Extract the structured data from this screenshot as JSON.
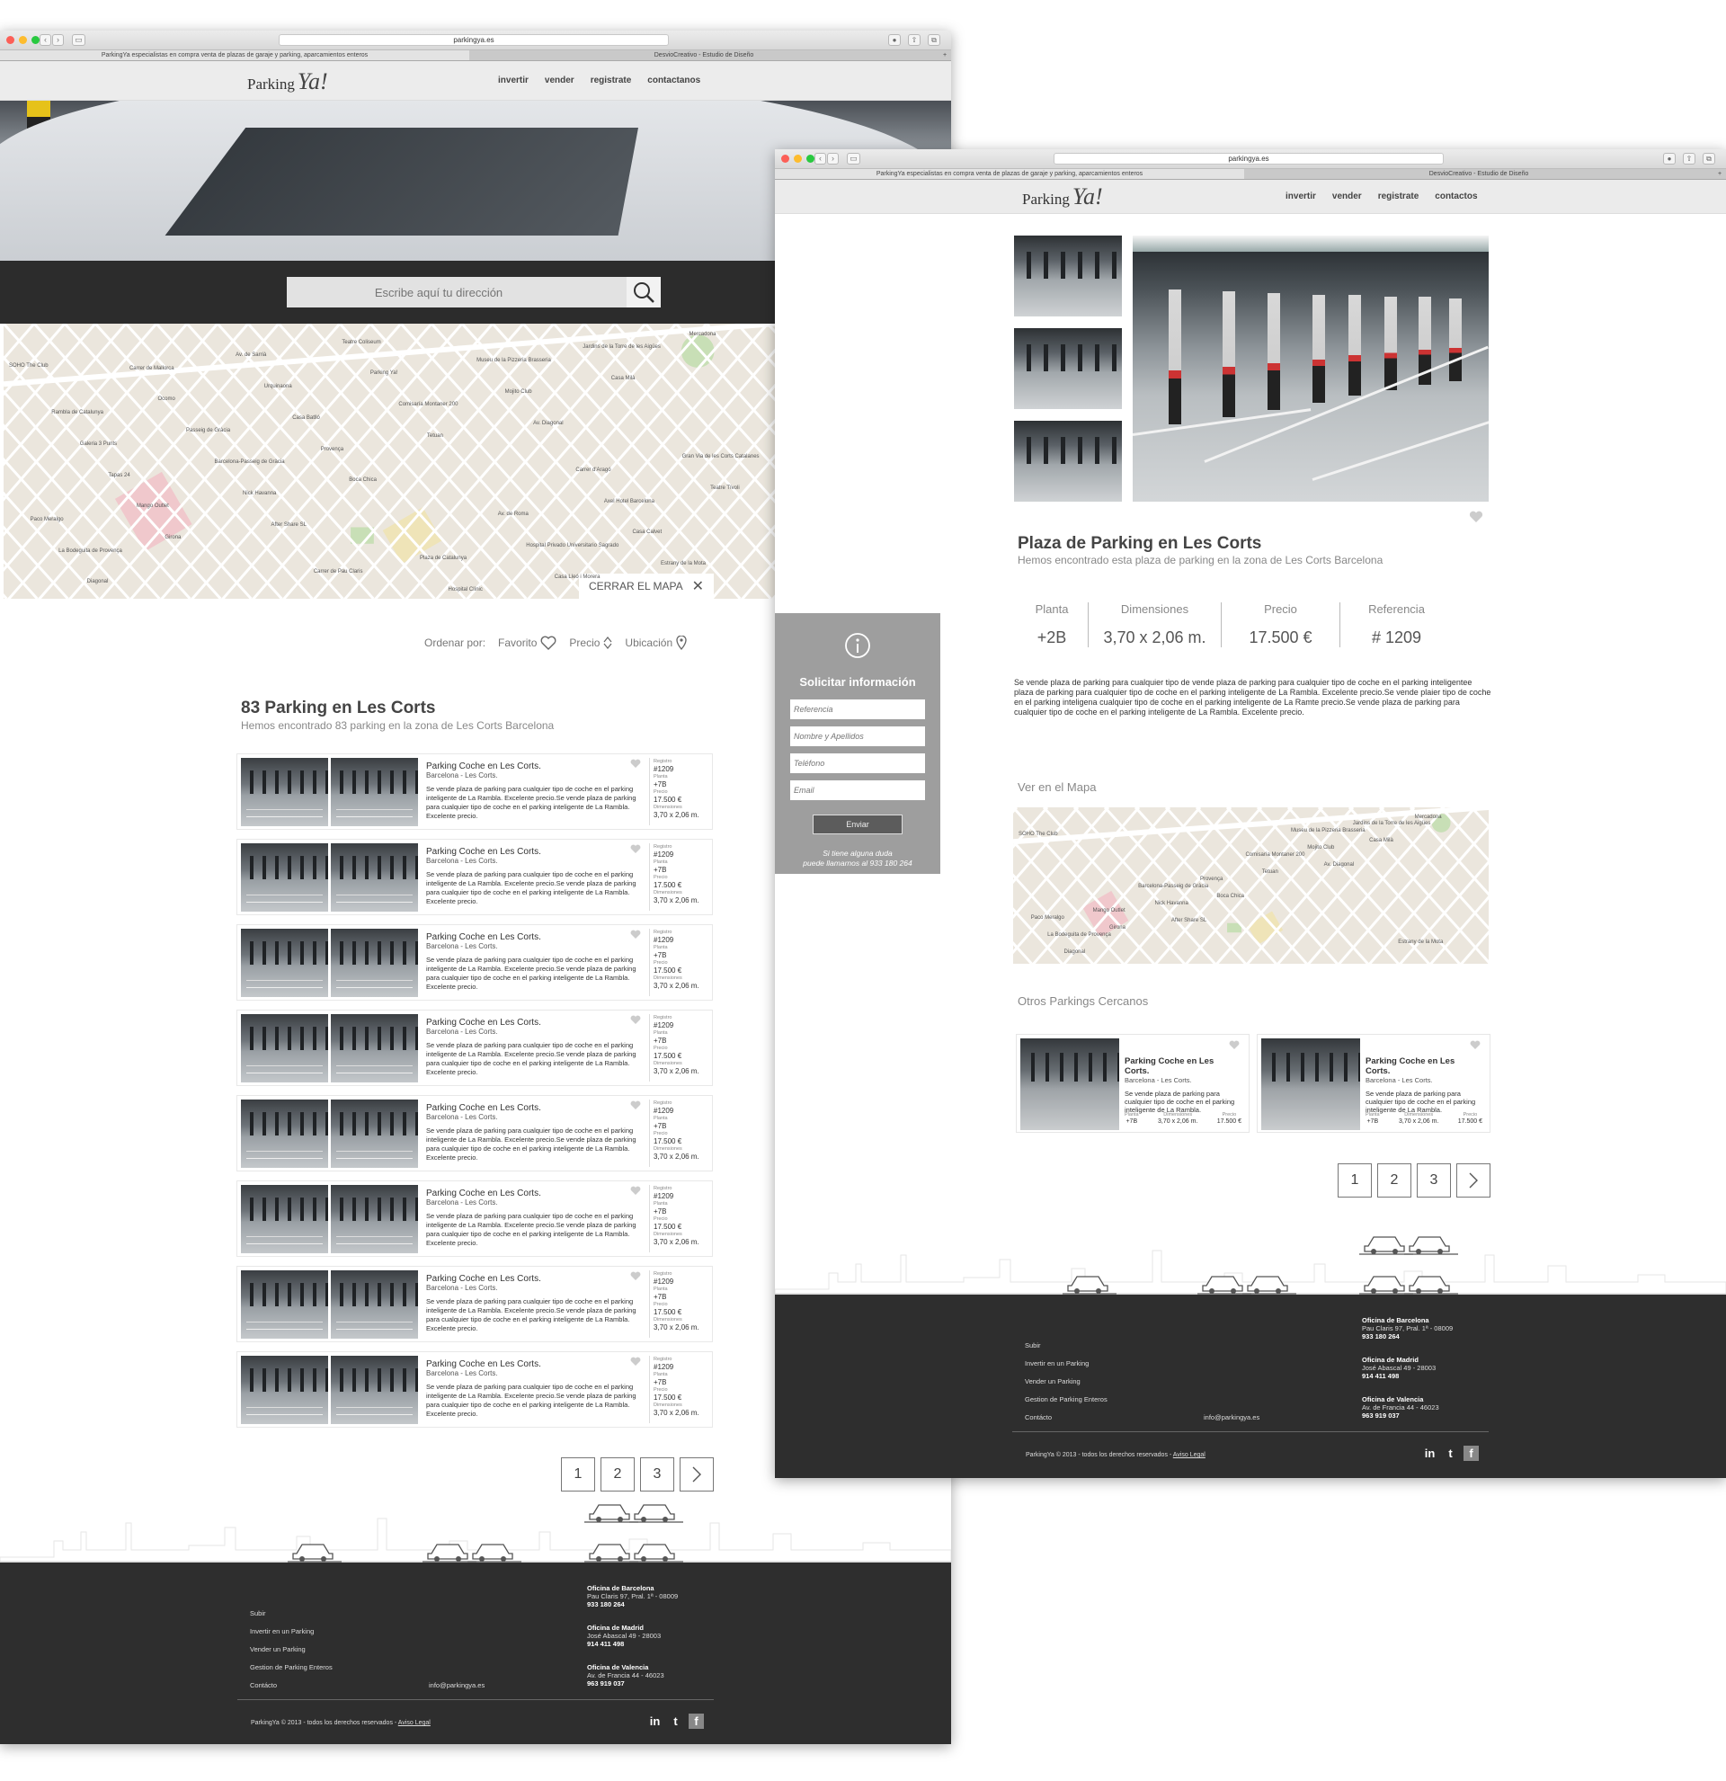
{
  "browser": {
    "url": "parkingya.es",
    "tab_active": "ParkingYa especialistas en compra venta de plazas de garaje y parking, aparcamientos enteros",
    "tab_other": "DesvioCreativo - Estudio de Diseño"
  },
  "brand": {
    "logo_text": "Parking",
    "logo_accent": "Ya!"
  },
  "nav": [
    "invertir",
    "vender",
    "registrate",
    "contactanos"
  ],
  "nav2": [
    "invertir",
    "vender",
    "registrate",
    "contactos"
  ],
  "search": {
    "placeholder": "Escribe aquí tu dirección"
  },
  "map": {
    "close_label": "CERRAR EL MAPA",
    "labels": [
      "SOHO The Club",
      "After Share SL",
      "Av. Diagonal",
      "Diagonal",
      "Boca Chica",
      "Casa Milà",
      "Girona",
      "Tetuan",
      "Mercadona",
      "Nick Havanna",
      "Mojito Club",
      "La Bodeguita de Provença",
      "Provença",
      "Jardins de la Torre de les Aigües",
      "Mango Outlet",
      "Comisaría Montaner 200",
      "Estrany de la Mota",
      "Barcelona-Passeig de Gràcia",
      "Museu de la Pizzeria Brasseria",
      "Paco Meralgo",
      "Casa Batlló",
      "Casa Lleó i Morera",
      "Tapas 24",
      "Parking Ya!",
      "Casa Calvet",
      "Passeig de Gràcia",
      "Hospital Clínic",
      "Teatre Tívoli",
      "Urquinaona",
      "Hospital Privado Universitario Sagrado",
      "Galeria 3 Punts",
      "Teatre Coliseum",
      "Axel Hotel Barcelona",
      "Ocomo",
      "Plaza de Catalunya",
      "Gran Via de les Corts Catalanes",
      "Av. de Sarrià",
      "Av. de Roma",
      "Rambla de Catalunya",
      "Carrer de Pau Claris",
      "Carrer d'Aragó",
      "Carrer de Mallorca"
    ]
  },
  "sort": {
    "label": "Ordenar por:",
    "options": [
      "Favorito",
      "Precio",
      "Ubicación"
    ]
  },
  "listing": {
    "title": "83 Parking en Les Corts",
    "subtitle": "Hemos encontrado 83 parking en la zona de Les Corts Barcelona",
    "items": [
      {
        "title": "Parking Coche en Les Corts.",
        "location": "Barcelona - Les Corts.",
        "desc": "Se vende plaza de parking para cualquier tipo de coche en el parking inteligente de La Rambla. Excelente precio.Se vende plaza de parking para cualquier tipo de coche en el parking inteligente de La Rambla. Excelente precio.",
        "registro_k": "Registro",
        "registro": "#1209",
        "planta_k": "Planta",
        "planta": "+7B",
        "precio_k": "Precio",
        "precio": "17.500 €",
        "dim_k": "Dimensiones",
        "dim": "3,70 x 2,06 m."
      },
      {
        "title": "Parking Coche en Les Corts.",
        "location": "Barcelona - Les Corts.",
        "desc": "Se vende plaza de parking para cualquier tipo de coche en el parking inteligente de La Rambla. Excelente precio.Se vende plaza de parking para cualquier tipo de coche en el parking inteligente de La Rambla. Excelente precio.",
        "registro_k": "Registro",
        "registro": "#1209",
        "planta_k": "Planta",
        "planta": "+7B",
        "precio_k": "Precio",
        "precio": "17.500 €",
        "dim_k": "Dimensiones",
        "dim": "3,70 x 2,06 m."
      },
      {
        "title": "Parking Coche en Les Corts.",
        "location": "Barcelona - Les Corts.",
        "desc": "Se vende plaza de parking para cualquier tipo de coche en el parking inteligente de La Rambla. Excelente precio.Se vende plaza de parking para cualquier tipo de coche en el parking inteligente de La Rambla. Excelente precio.",
        "registro_k": "Registro",
        "registro": "#1209",
        "planta_k": "Planta",
        "planta": "+7B",
        "precio_k": "Precio",
        "precio": "17.500 €",
        "dim_k": "Dimensiones",
        "dim": "3,70 x 2,06 m."
      },
      {
        "title": "Parking Coche en Les Corts.",
        "location": "Barcelona - Les Corts.",
        "desc": "Se vende plaza de parking para cualquier tipo de coche en el parking inteligente de La Rambla. Excelente precio.Se vende plaza de parking para cualquier tipo de coche en el parking inteligente de La Rambla. Excelente precio.",
        "registro_k": "Registro",
        "registro": "#1209",
        "planta_k": "Planta",
        "planta": "+7B",
        "precio_k": "Precio",
        "precio": "17.500 €",
        "dim_k": "Dimensiones",
        "dim": "3,70 x 2,06 m."
      },
      {
        "title": "Parking Coche en Les Corts.",
        "location": "Barcelona - Les Corts.",
        "desc": "Se vende plaza de parking para cualquier tipo de coche en el parking inteligente de La Rambla. Excelente precio.Se vende plaza de parking para cualquier tipo de coche en el parking inteligente de La Rambla. Excelente precio.",
        "registro_k": "Registro",
        "registro": "#1209",
        "planta_k": "Planta",
        "planta": "+7B",
        "precio_k": "Precio",
        "precio": "17.500 €",
        "dim_k": "Dimensiones",
        "dim": "3,70 x 2,06 m."
      },
      {
        "title": "Parking Coche en Les Corts.",
        "location": "Barcelona - Les Corts.",
        "desc": "Se vende plaza de parking para cualquier tipo de coche en el parking inteligente de La Rambla. Excelente precio.Se vende plaza de parking para cualquier tipo de coche en el parking inteligente de La Rambla. Excelente precio.",
        "registro_k": "Registro",
        "registro": "#1209",
        "planta_k": "Planta",
        "planta": "+7B",
        "precio_k": "Precio",
        "precio": "17.500 €",
        "dim_k": "Dimensiones",
        "dim": "3,70 x 2,06 m."
      },
      {
        "title": "Parking Coche en Les Corts.",
        "location": "Barcelona - Les Corts.",
        "desc": "Se vende plaza de parking para cualquier tipo de coche en el parking inteligente de La Rambla. Excelente precio.Se vende plaza de parking para cualquier tipo de coche en el parking inteligente de La Rambla. Excelente precio.",
        "registro_k": "Registro",
        "registro": "#1209",
        "planta_k": "Planta",
        "planta": "+7B",
        "precio_k": "Precio",
        "precio": "17.500 €",
        "dim_k": "Dimensiones",
        "dim": "3,70 x 2,06 m."
      },
      {
        "title": "Parking Coche en Les Corts.",
        "location": "Barcelona - Les Corts.",
        "desc": "Se vende plaza de parking para cualquier tipo de coche en el parking inteligente de La Rambla. Excelente precio.Se vende plaza de parking para cualquier tipo de coche en el parking inteligente de La Rambla. Excelente precio.",
        "registro_k": "Registro",
        "registro": "#1209",
        "planta_k": "Planta",
        "planta": "+7B",
        "precio_k": "Precio",
        "precio": "17.500 €",
        "dim_k": "Dimensiones",
        "dim": "3,70 x 2,06 m."
      }
    ]
  },
  "pagination": [
    "1",
    "2",
    "3"
  ],
  "footer": {
    "links": [
      "Subir",
      "Invertir en un Parking",
      "Vender un Parking",
      "Gestion de Parking Enteros",
      "Contácto"
    ],
    "email": "info@parkingya.es",
    "offices": [
      {
        "name": "Oficina de Barcelona",
        "address": "Pau Claris 97, Pral. 1ª - 08009",
        "phone": "933 180 264"
      },
      {
        "name": "Oficina de Madrid",
        "address": "José Abascal 49 - 28003",
        "phone": "914 411 498"
      },
      {
        "name": "Oficina de Valencia",
        "address": "Av. de Francia 44 - 46023",
        "phone": "963 919 037"
      }
    ],
    "copyright": "ParkingYa © 2013 - todos los derechos reservados - ",
    "legal": "Aviso Legal",
    "social": [
      "in",
      "t",
      "f"
    ]
  },
  "detail": {
    "title": "Plaza de Parking en Les Corts",
    "subtitle": "Hemos encontrado esta plaza de parking en la zona de Les Corts Barcelona",
    "specs": [
      {
        "label": "Planta",
        "value": "+2B"
      },
      {
        "label": "Dimensiones",
        "value": "3,70 x 2,06 m."
      },
      {
        "label": "Precio",
        "value": "17.500 €"
      },
      {
        "label": "Referencia",
        "value": "# 1209"
      }
    ],
    "description": "Se vende plaza de parking para cualquier tipo de vende plaza de parking para cualquier tipo de coche en el parking inteligentee plaza de parking para cualquier tipo de coche en el parking inteligente de La Rambla. Excelente precio.Se vende plaier tipo de coche en el parking inteligena cualquier tipo de coche en el parking inteligente de La Ramte precio.Se vende plaza de parking para cualquier tipo de coche en el parking inteligente de La Rambla. Excelente precio.",
    "map_section": "Ver en el Mapa",
    "nearby_section": "Otros Parkings Cercanos",
    "nearby": [
      {
        "title": "Parking Coche en Les Corts.",
        "location": "Barcelona - Les Corts.",
        "desc": "Se vende plaza de parking para cualquier tipo de coche en el parking inteligente de La Rambla.",
        "planta_k": "Planta",
        "planta": "+7B",
        "dim_k": "Dimensiones",
        "dim": "3,70 x 2,06 m.",
        "precio_k": "Precio",
        "precio": "17.500 €"
      },
      {
        "title": "Parking Coche en Les Corts.",
        "location": "Barcelona - Les Corts.",
        "desc": "Se vende plaza de parking para cualquier tipo de coche en el parking inteligente de La Rambla.",
        "planta_k": "Planta",
        "planta": "+7B",
        "dim_k": "Dimensiones",
        "dim": "3,70 x 2,06 m.",
        "precio_k": "Precio",
        "precio": "17.500 €"
      }
    ]
  },
  "contact_form": {
    "title": "Solicitar información",
    "ref_placeholder": "Referencia",
    "name_placeholder": "Nombre y Apellidos",
    "phone_placeholder": "Teléfono",
    "email_placeholder": "Email",
    "send_label": "Enviar",
    "note_line1": "Si tiene alguna duda",
    "note_line2": "puede llamarnos al 933 180 264"
  }
}
